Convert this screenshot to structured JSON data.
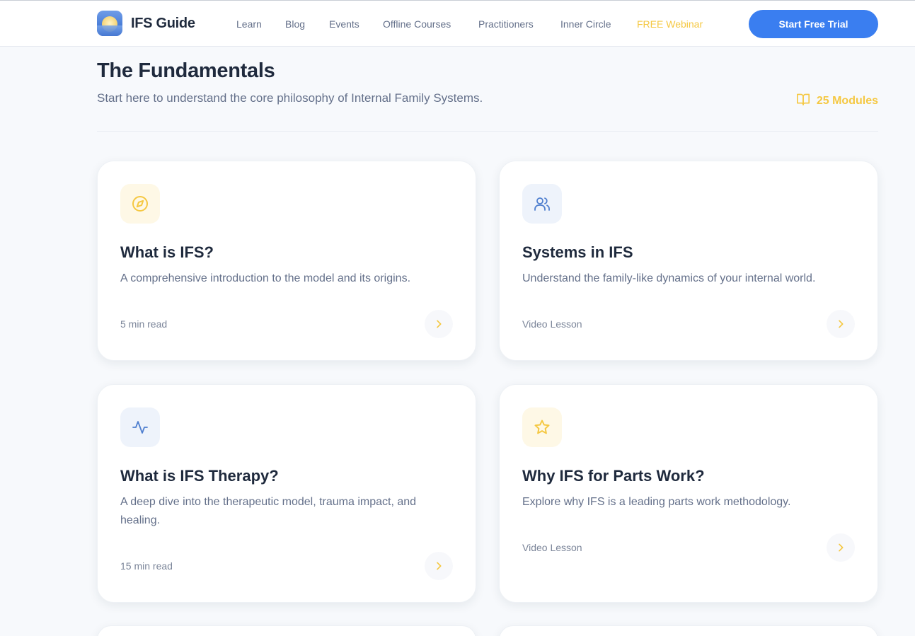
{
  "header": {
    "brand": "IFS Guide",
    "nav": [
      "Learn",
      "Blog",
      "Events",
      "Offline Courses",
      "Practitioners",
      "Inner Circle",
      "FREE Webinar"
    ],
    "cta": "Start Free Trial"
  },
  "section": {
    "title": "The Fundamentals",
    "subtitle": "Start here to understand the core philosophy of Internal Family Systems.",
    "modules": "25 Modules"
  },
  "cards": [
    {
      "icon": "compass-icon",
      "title": "What is IFS?",
      "desc": "A comprehensive introduction to the model and its origins.",
      "meta": "5 min read"
    },
    {
      "icon": "users-icon",
      "title": "Systems in IFS",
      "desc": "Understand the family-like dynamics of your internal world.",
      "meta": "Video Lesson"
    },
    {
      "icon": "activity-icon",
      "title": "What is IFS Therapy?",
      "desc": "A deep dive into the therapeutic model, trauma impact, and healing.",
      "meta": "15 min read"
    },
    {
      "icon": "star-icon",
      "title": "Why IFS for Parts Work?",
      "desc": "Explore why IFS is a leading parts work methodology.",
      "meta": "Video Lesson"
    }
  ],
  "colors": {
    "accent_blue": "#3a7ef0",
    "accent_yellow": "#f5c842",
    "text_dark": "#1f2a3d",
    "text_muted": "#64708a"
  }
}
